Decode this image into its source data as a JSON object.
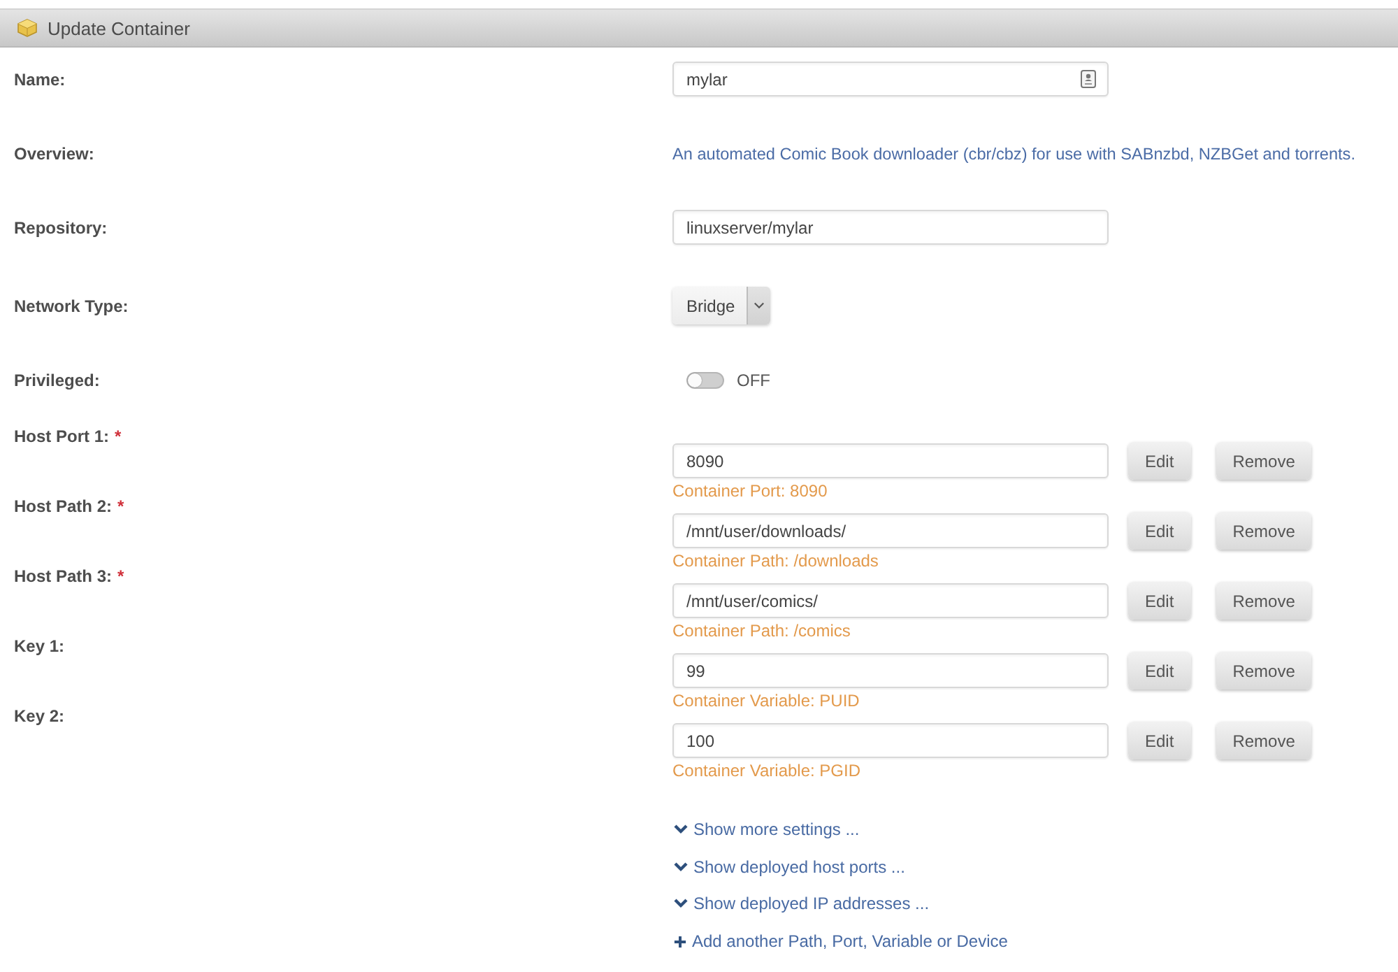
{
  "header": {
    "title": "Update Container"
  },
  "fields": [
    {
      "kind": "text",
      "label": "Name:",
      "value": "mylar"
    },
    {
      "kind": "description",
      "label": "Overview:",
      "text": "An automated Comic Book downloader (cbr/cbz) for use with SABnzbd, NZBGet and torrents."
    },
    {
      "kind": "text",
      "label": "Repository:",
      "value": "linuxserver/mylar"
    },
    {
      "kind": "select",
      "label": "Network Type:",
      "value": "Bridge"
    },
    {
      "kind": "toggle",
      "label": "Privileged:",
      "on": false,
      "state_label": "OFF"
    }
  ],
  "config": [
    {
      "label": "Host Port 1:",
      "required_mark": "*",
      "value": "8090",
      "target": "Container Port: 8090",
      "buttons": [
        "Edit",
        "Remove"
      ]
    },
    {
      "label": "Host Path 2:",
      "required_mark": "*",
      "value": "/mnt/user/downloads/",
      "target": "Container Path: /downloads",
      "buttons": [
        "Edit",
        "Remove"
      ]
    },
    {
      "label": "Host Path 3:",
      "required_mark": "*",
      "value": "/mnt/user/comics/",
      "target": "Container Path: /comics",
      "buttons": [
        "Edit",
        "Remove"
      ]
    },
    {
      "label": "Key 1:",
      "value": "99",
      "target": "Container Variable: PUID",
      "buttons": [
        "Edit",
        "Remove"
      ]
    },
    {
      "label": "Key 2:",
      "value": "100",
      "target": "Container Variable: PGID",
      "buttons": [
        "Edit",
        "Remove"
      ]
    }
  ],
  "links": [
    {
      "kind": "expand",
      "label": "Show more settings ..."
    },
    {
      "kind": "expand",
      "label": "Show deployed host ports ..."
    },
    {
      "kind": "expand",
      "label": "Show deployed IP addresses ..."
    },
    {
      "kind": "add",
      "label": "Add another Path, Port, Variable or Device"
    }
  ]
}
